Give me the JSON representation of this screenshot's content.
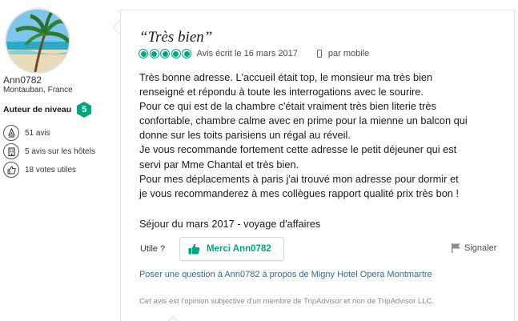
{
  "member": {
    "username": "Ann0782",
    "location": "Montauban, France",
    "level_label": "Auteur de niveau",
    "level": "5",
    "stats": [
      {
        "icon": "pen-icon",
        "text": "51 avis"
      },
      {
        "icon": "hotel-icon",
        "text": "5 avis sur les hôtels"
      },
      {
        "icon": "thumbs-up-icon",
        "text": "18 votes utiles"
      }
    ]
  },
  "review": {
    "title": "“Très bien”",
    "rating": 5,
    "date": "Avis écrit le 16 mars 2017",
    "device": "par mobile",
    "body_lines": [
      "Très bonne adresse. L'accueil était top, le monsieur ma très bien",
      "renseigné et répondu à toute les interrogations avec le sourire.",
      "Pour ce qui est de la chambre c'était vraiment très bien literie très",
      "confortable, chambre calme avec en prime pour la mienne un balcon qui",
      "donne sur les toits parisiens un régal au réveil.",
      "Je vous recommande fortement cette adresse le petit déjeuner qui est",
      "servi par Mme Chantal et très bien.",
      "Pour mes déplacements à paris j'ai trouvé mon adresse pour dormir et",
      "je vous recommanderez à mes collègues rapport qualité prix très bon !"
    ],
    "stay": "Séjour du mars 2017 - voyage d'affaires",
    "helpful_label": "Utile ?",
    "thanks_button": "Merci Ann0782",
    "report_label": "Signaler",
    "question_link": "Poser une question à Ann0782 à propos de Migny Hotel Opera Montmartre",
    "disclaimer": "Cet avis est l'opinion subjective d'un membre de TripAdvisor et non de TripAdvisor LLC."
  },
  "colors": {
    "accent_green": "#00a680",
    "link_blue": "#2f6b9a",
    "level_badge": "#00a680"
  }
}
